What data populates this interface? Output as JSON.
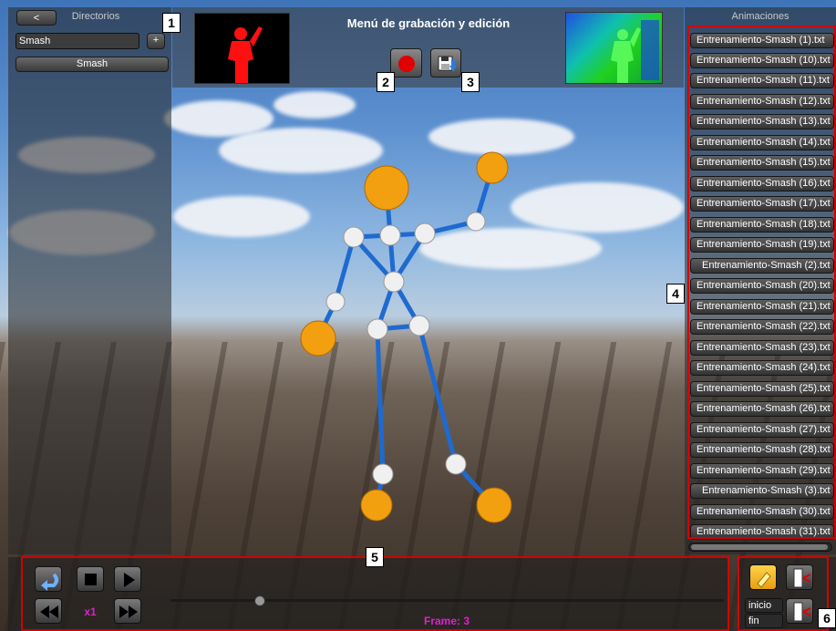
{
  "directories": {
    "title": "Directorios",
    "back_label": "<",
    "name_value": "Smash",
    "add_label": "+",
    "items": [
      "Smash"
    ]
  },
  "header": {
    "title": "Menú de grabación y edición"
  },
  "animations": {
    "title": "Animaciones",
    "items": [
      "Entrenamiento-Smash (1).txt",
      "Entrenamiento-Smash (10).txt",
      "Entrenamiento-Smash (11).txt",
      "Entrenamiento-Smash (12).txt",
      "Entrenamiento-Smash (13).txt",
      "Entrenamiento-Smash (14).txt",
      "Entrenamiento-Smash (15).txt",
      "Entrenamiento-Smash (16).txt",
      "Entrenamiento-Smash (17).txt",
      "Entrenamiento-Smash (18).txt",
      "Entrenamiento-Smash (19).txt",
      "Entrenamiento-Smash (2).txt",
      "Entrenamiento-Smash (20).txt",
      "Entrenamiento-Smash (21).txt",
      "Entrenamiento-Smash (22).txt",
      "Entrenamiento-Smash (23).txt",
      "Entrenamiento-Smash (24).txt",
      "Entrenamiento-Smash (25).txt",
      "Entrenamiento-Smash (26).txt",
      "Entrenamiento-Smash (27).txt",
      "Entrenamiento-Smash (28).txt",
      "Entrenamiento-Smash (29).txt",
      "Entrenamiento-Smash (3).txt",
      "Entrenamiento-Smash (30).txt",
      "Entrenamiento-Smash (31).txt"
    ]
  },
  "playback": {
    "speed_label": "x1",
    "frame_label": "Frame: 3",
    "timeline_position": 0.16
  },
  "edit": {
    "start_value": "inicio",
    "end_value": "fin"
  },
  "callouts": [
    "1",
    "2",
    "3",
    "4",
    "5",
    "6"
  ],
  "colors": {
    "record": "#e00000",
    "accent_magenta": "#e020d0",
    "joint_orange": "#f2a010",
    "bone_blue": "#1f6ad0",
    "annotation_red": "#d40000"
  },
  "icons": {
    "record": "record-icon",
    "save": "save-icon",
    "undo": "undo-icon",
    "stop": "stop-icon",
    "play": "play-icon",
    "rewind": "rewind-icon",
    "fast_forward": "fast-forward-icon",
    "highlight": "highlighter-icon",
    "cut": "cut-frames-icon"
  }
}
